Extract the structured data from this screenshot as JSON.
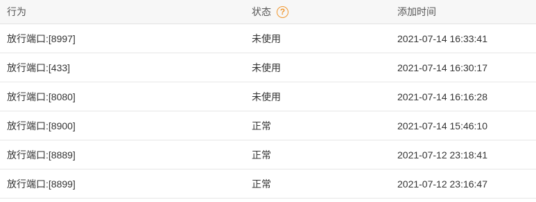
{
  "table": {
    "headers": {
      "action": "行为",
      "status": "状态",
      "status_help_icon": "?",
      "time": "添加时间"
    },
    "rows": [
      {
        "action": "放行端口:[8997]",
        "status": "未使用",
        "time": "2021-07-14 16:33:41"
      },
      {
        "action": "放行端口:[433]",
        "status": "未使用",
        "time": "2021-07-14 16:30:17"
      },
      {
        "action": "放行端口:[8080]",
        "status": "未使用",
        "time": "2021-07-14 16:16:28"
      },
      {
        "action": "放行端口:[8900]",
        "status": "正常",
        "time": "2021-07-14 15:46:10"
      },
      {
        "action": "放行端口:[8889]",
        "status": "正常",
        "time": "2021-07-12 23:18:41"
      },
      {
        "action": "放行端口:[8899]",
        "status": "正常",
        "time": "2021-07-12 23:16:47"
      }
    ]
  },
  "colors": {
    "help_icon": "#f0962d",
    "header_bg": "#f7f7f7",
    "row_border": "#e6e6e6"
  }
}
